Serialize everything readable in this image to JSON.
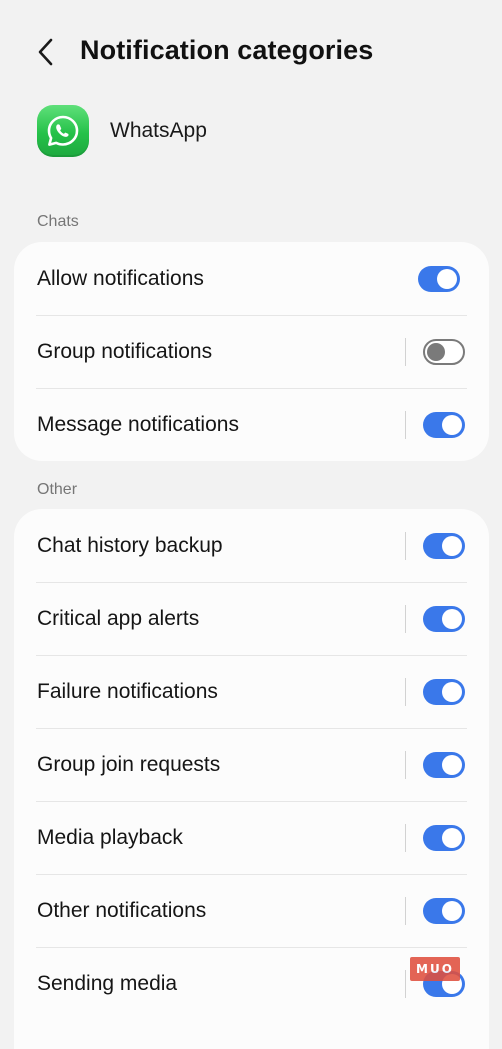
{
  "header": {
    "title": "Notification categories",
    "back_icon": "chevron-left-icon"
  },
  "app": {
    "name": "WhatsApp",
    "icon": "whatsapp-icon",
    "icon_color": "#25c149"
  },
  "sections": [
    {
      "label": "Chats",
      "items": [
        {
          "label": "Allow notifications",
          "enabled": true
        },
        {
          "label": "Group notifications",
          "enabled": false
        },
        {
          "label": "Message notifications",
          "enabled": true
        }
      ]
    },
    {
      "label": "Other",
      "items": [
        {
          "label": "Chat history backup",
          "enabled": true
        },
        {
          "label": "Critical app alerts",
          "enabled": true
        },
        {
          "label": "Failure notifications",
          "enabled": true
        },
        {
          "label": "Group join requests",
          "enabled": true
        },
        {
          "label": "Media playback",
          "enabled": true
        },
        {
          "label": "Other notifications",
          "enabled": true
        },
        {
          "label": "Sending media",
          "enabled": true
        }
      ]
    }
  ],
  "watermark": {
    "text": "MUO"
  },
  "colors": {
    "accent": "#3a78ea",
    "background": "#f2f2f2",
    "card": "#fcfcfc",
    "toggle_off": "#7a7a7a"
  }
}
